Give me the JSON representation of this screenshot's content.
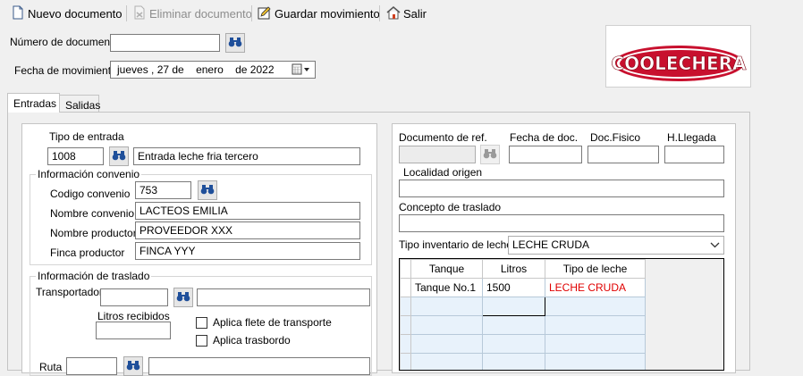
{
  "toolbar": {
    "new_doc": "Nuevo documento",
    "delete_doc": "Eliminar documento",
    "save": "Guardar movimiento",
    "exit": "Salir"
  },
  "header": {
    "doc_number_label": "Número de documento",
    "doc_number_value": "",
    "date_label": "Fecha de movimiento",
    "date_weekday": "jueves",
    "date_day": ", 27 de",
    "date_month": "enero",
    "date_year": "de 2022"
  },
  "logo": {
    "text": "COOLECHERA"
  },
  "tabs": [
    {
      "label": "Entradas",
      "active": true
    },
    {
      "label": "Salidas",
      "active": false
    }
  ],
  "entry": {
    "type_label": "Tipo de entrada",
    "type_code": "1008",
    "type_desc": "Entrada leche fria tercero",
    "agreement_group": "Información convenio",
    "agreement_code_label": "Codigo convenio",
    "agreement_code": "753",
    "agreement_name_label": "Nombre convenio",
    "agreement_name": "LACTEOS EMILIA",
    "producer_name_label": "Nombre productor",
    "producer_name": "PROVEEDOR XXX",
    "farm_label": "Finca productor",
    "farm": "FINCA YYY",
    "transfer_group": "Información de traslado",
    "transporter_label": "Transportador",
    "transporter_code": "",
    "transporter_name": "",
    "liters_received_label": "Litros recibidos",
    "liters_received": "",
    "freight_label": "Aplica flete de transporte",
    "transfer_label": "Aplica trasbordo",
    "route_label": "Ruta"
  },
  "ref": {
    "doc_ref_label": "Documento de ref.",
    "doc_date_label": "Fecha de doc.",
    "doc_physical_label": "Doc.Fisico",
    "arrival_label": "H.Llegada",
    "origin_label": "Localidad origen",
    "concept_label": "Concepto de traslado",
    "inventory_type_label": "Tipo inventario de leche",
    "inventory_type_value": "LECHE CRUDA"
  },
  "grid": {
    "columns": [
      "Tanque",
      "Litros",
      "Tipo de leche"
    ],
    "rows": [
      {
        "tank": "Tanque No.1",
        "liters": "1500",
        "type": "LECHE CRUDA"
      }
    ],
    "type_color": "#e00000",
    "selection_color": "#0a64c8"
  }
}
